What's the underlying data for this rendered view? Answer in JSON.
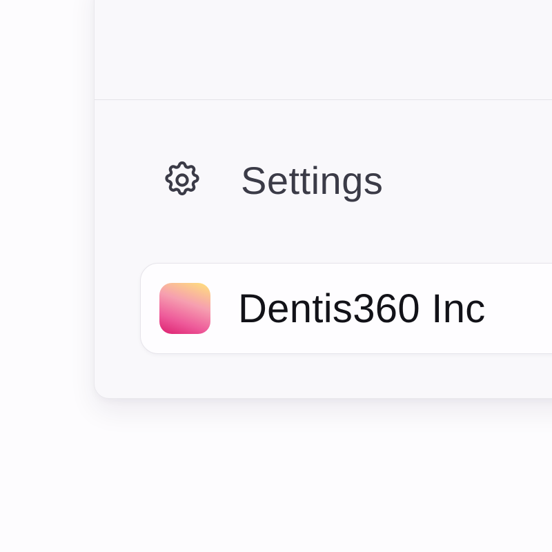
{
  "sidebar": {
    "settings": {
      "label": "Settings",
      "icon": "gear-icon"
    },
    "org_switcher": {
      "name": "Dentis360 Inc",
      "logo_gradient": [
        "#ffe27a",
        "#f69fb0",
        "#ee5a9a",
        "#dc1f6f"
      ]
    }
  },
  "colors": {
    "panel_bg": "#f9f8fb",
    "text_primary": "#121218",
    "text_secondary": "#3b3b47"
  }
}
